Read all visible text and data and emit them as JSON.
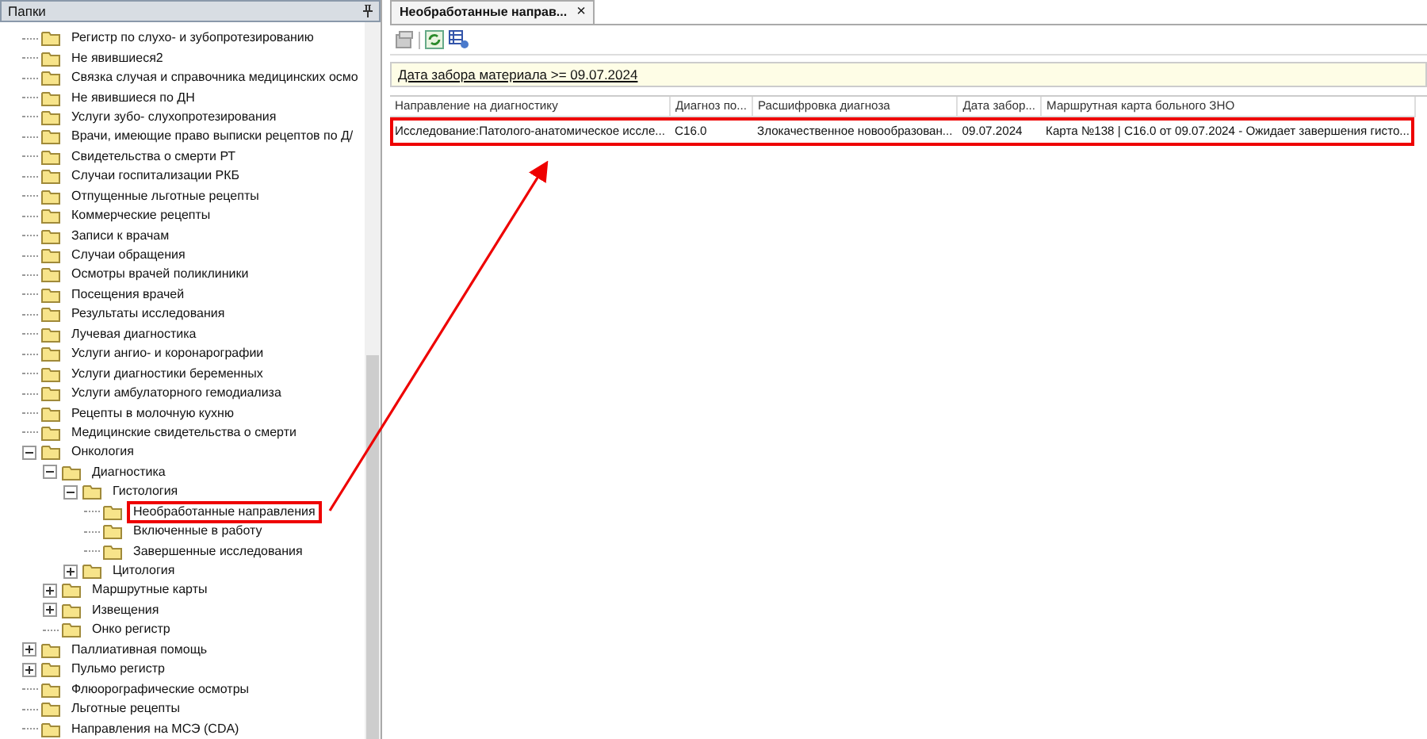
{
  "folders_panel": {
    "title": "Папки",
    "tree": [
      {
        "label": "Регистр по слухо- и зубопротезированию",
        "selected": false
      },
      {
        "label": "Не явившиеся2",
        "selected": false
      },
      {
        "label": "Связка случая и справочника медицинских осмо",
        "selected": false
      },
      {
        "label": "Не явившиеся по ДН",
        "selected": false
      },
      {
        "label": "Услуги зубо- слухопротезирования",
        "selected": false
      },
      {
        "label": "Врачи, имеющие право выписки рецептов по Д/",
        "selected": false
      },
      {
        "label": "Свидетельства о смерти РТ",
        "selected": false
      },
      {
        "label": "Случаи госпитализации РКБ",
        "selected": false
      },
      {
        "label": "Отпущенные льготные рецепты",
        "selected": false
      },
      {
        "label": "Коммерческие рецепты",
        "selected": false
      },
      {
        "label": "Записи к врачам",
        "selected": false
      },
      {
        "label": "Случаи обращения",
        "selected": false
      },
      {
        "label": "Осмотры врачей поликлиники",
        "selected": false
      },
      {
        "label": "Посещения врачей",
        "selected": false
      },
      {
        "label": "Результаты исследования",
        "selected": false
      },
      {
        "label": "Лучевая диагностика",
        "selected": false
      },
      {
        "label": "Услуги ангио- и коронарографии",
        "selected": false
      },
      {
        "label": "Услуги диагностики беременных",
        "selected": false
      },
      {
        "label": "Услуги амбулаторного гемодиализа",
        "selected": false
      },
      {
        "label": "Рецепты в молочную кухню",
        "selected": false
      },
      {
        "label": "Медицинские свидетельства о смерти",
        "selected": false
      },
      {
        "label": "Онкология",
        "selected": false,
        "expanded": true,
        "children": [
          {
            "label": "Диагностика",
            "selected": false,
            "expanded": true,
            "children": [
              {
                "label": "Гистология",
                "selected": false,
                "expanded": true,
                "children": [
                  {
                    "label": "Необработанные направления",
                    "selected": true
                  },
                  {
                    "label": "Включенные в работу",
                    "selected": false
                  },
                  {
                    "label": "Завершенные исследования",
                    "selected": false
                  }
                ]
              },
              {
                "label": "Цитология",
                "selected": false,
                "expanded": false
              }
            ]
          },
          {
            "label": "Маршрутные карты",
            "selected": false,
            "expanded": false
          },
          {
            "label": "Извещения",
            "selected": false,
            "expanded": false
          },
          {
            "label": "Онко регистр",
            "selected": false
          }
        ]
      },
      {
        "label": "Паллиативная помощь",
        "selected": false,
        "expanded": false
      },
      {
        "label": "Пульмо регистр",
        "selected": false,
        "expanded": false
      },
      {
        "label": "Флюорографические осмотры",
        "selected": false
      },
      {
        "label": "Льготные рецепты",
        "selected": false
      },
      {
        "label": "Направления на МСЭ (CDA)",
        "selected": false
      }
    ]
  },
  "tab": {
    "label": "Необработанные направ...",
    "close": "×"
  },
  "filter": "Дата забора материала >= 09.07.2024",
  "table": {
    "columns": [
      "Направление на диагностику",
      "Диагноз по...",
      "Расшифровка диагноза",
      "Дата забор...",
      "Маршрутная карта больного ЗНО"
    ],
    "rows": [
      {
        "highlighted": true,
        "cells": [
          "Исследование:Патолого-анатомическое иссле...",
          "C16.0",
          "Злокачественное новообразован...",
          "09.07.2024",
          "Карта №138 | C16.0 от 09.07.2024 - Ожидает завершения гисто..."
        ]
      }
    ]
  }
}
